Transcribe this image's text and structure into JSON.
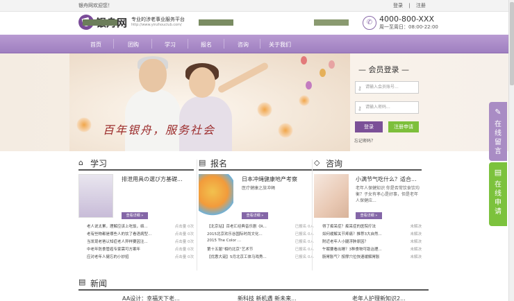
{
  "topbar": {
    "welcome": "银舟网欢迎您！",
    "login": "登录",
    "sep": "|",
    "register": "注册"
  },
  "header": {
    "logo_name": "银舟网",
    "tagline": "专业的涉老事业服务平台",
    "url": "http://www.yinzhouclub.com/",
    "phone": "4000-800-XXX",
    "hours": "周一至周日：08:00-22:00"
  },
  "nav": [
    "首页",
    "团购",
    "学习",
    "报名",
    "咨询",
    "关于我们"
  ],
  "banner": {
    "slogan": "百年银舟，服务社会"
  },
  "login": {
    "title": "— 会员登录 —",
    "account_placeholder": "请输入会员账号...",
    "password_placeholder": "请输入密码...",
    "login_button": "登录",
    "register_button": "注册申请",
    "forgot": "忘记密码？"
  },
  "sections": [
    {
      "title": "学习",
      "feature_title": "排泄用具の選び方基礎...",
      "more": "查看详细 »",
      "rows": [
        {
          "t": "老人说太累，理解应该上吃饭，络...",
          "d": "点击量 0次"
        },
        {
          "t": "老有些物都是哪些人的饮了看语病型...",
          "d": "点击量 0次"
        },
        {
          "t": "当发现老爸认知症老人异样要因注...",
          "d": "点击量 0次"
        },
        {
          "t": "中老年防食管癌专家需可方案年",
          "d": "点击量 0次"
        },
        {
          "t": "应对老年人健忘的小妙招",
          "d": "点击量 0次"
        }
      ]
    },
    {
      "title": "报名",
      "feature_title": "日本冲绳健康地产考察",
      "feature_desc": "医疗健康之旅冲绳",
      "more": "查看详细 »",
      "rows": [
        {
          "t": "【北京站】百老汇经典音乐剧《R...",
          "d": "已报名 0人"
        },
        {
          "t": "2015北京欢乐谷国际时尚文化...",
          "d": "已报名 0人"
        },
        {
          "t": "2015 The Color ...",
          "d": "已报名 0人"
        },
        {
          "t": "第十五届“相约北京”艺术节",
          "d": "已报名 0人"
        },
        {
          "t": "【优惠大诞】5月北京工体马戏秀...",
          "d": "已报名 0人"
        }
      ]
    },
    {
      "title": "咨询",
      "feature_title": "小满节气吃什么？适合...",
      "feature_desc": "老年人保健知识 你是否常饮食饮均衡？子女有孝心是好事，但是老年人保健应...",
      "more": "查看详细 »",
      "rows": [
        {
          "t": "得了痴呆症？痴呆症的医院疗法",
          "d": "未解决"
        },
        {
          "t": "如何缓解关节疼痛？推荐3大自然...",
          "d": "未解决"
        },
        {
          "t": "附近老年人小腿浮肿原因？",
          "d": "未解决"
        },
        {
          "t": "午眠要看出睡？3种食物可助治理...",
          "d": "未解决"
        },
        {
          "t": "肠胃胀气？按摩穴位快速缓解胃胀",
          "d": "未解决"
        }
      ]
    }
  ],
  "news": {
    "title": "新闻",
    "items": [
      "AA设计：幸福天下老...",
      "新科技 新机遇 新未来...",
      "老年人护理新知识2..."
    ]
  },
  "side_tabs": [
    {
      "label": "在线留言",
      "color": "#a98cc4"
    },
    {
      "label": "在线申请",
      "color": "#7cc23d"
    }
  ],
  "colors": {
    "nav": "#a888c8",
    "accent": "#7b5097",
    "green": "#7dbf3b"
  }
}
